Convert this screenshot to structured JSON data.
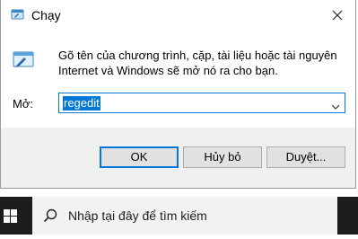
{
  "window": {
    "title": "Chạy"
  },
  "dialog": {
    "description": "Gõ tên của chương trình, cặp, tài liệu hoặc tài nguyên Internet và Windows sẽ mở nó ra cho bạn.",
    "open_label": "Mở:",
    "input_value": "regedit"
  },
  "buttons": {
    "ok": "OK",
    "cancel": "Hủy bỏ",
    "browse": "Duyệt..."
  },
  "taskbar": {
    "search_placeholder": "Nhập tại đây để tìm kiếm"
  },
  "colors": {
    "accent": "#0078d7",
    "taskbar": "#1c1c1c",
    "footer": "#f0f0f0"
  }
}
